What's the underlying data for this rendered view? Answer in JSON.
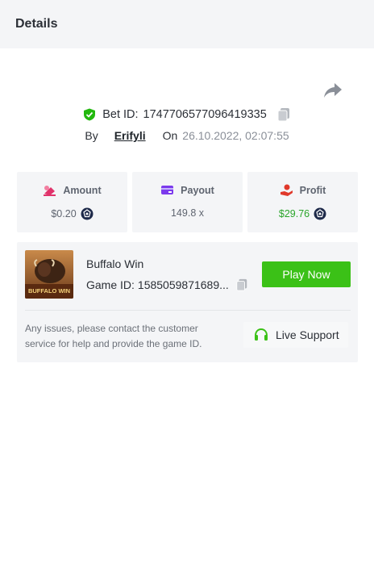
{
  "header": {
    "title": "Details"
  },
  "bet": {
    "id_label": "Bet ID:",
    "id_value": "1747706577096419335",
    "by_label": "By",
    "user": "Erifyli",
    "on_label": "On",
    "datetime": "26.10.2022, 02:07:55"
  },
  "stats": {
    "amount": {
      "label": "Amount",
      "value": "$0.20"
    },
    "payout": {
      "label": "Payout",
      "value": "149.8 x"
    },
    "profit": {
      "label": "Profit",
      "value": "$29.76"
    }
  },
  "game": {
    "thumb_text": "BUFFALO WIN",
    "name": "Buffalo Win",
    "id_label": "Game ID:",
    "id_value": "1585059871689...",
    "play_label": "Play Now"
  },
  "support": {
    "message": "Any issues, please contact the customer service for help and provide the game ID.",
    "button_label": "Live Support"
  },
  "icons": {
    "share": "share-icon",
    "shield": "shield-check-icon",
    "copy": "copy-icon",
    "amount": "amount-icon",
    "payout": "wallet-icon",
    "profit": "profit-hand-icon",
    "coin": "coin-icon",
    "headset": "headset-icon"
  },
  "colors": {
    "accent_green": "#3bc117",
    "profit_green": "#2aa52a",
    "amount_pink": "#e0336b",
    "payout_purple": "#7c3aed",
    "profit_red": "#e0392b",
    "coin_navy": "#1e2a4a"
  }
}
